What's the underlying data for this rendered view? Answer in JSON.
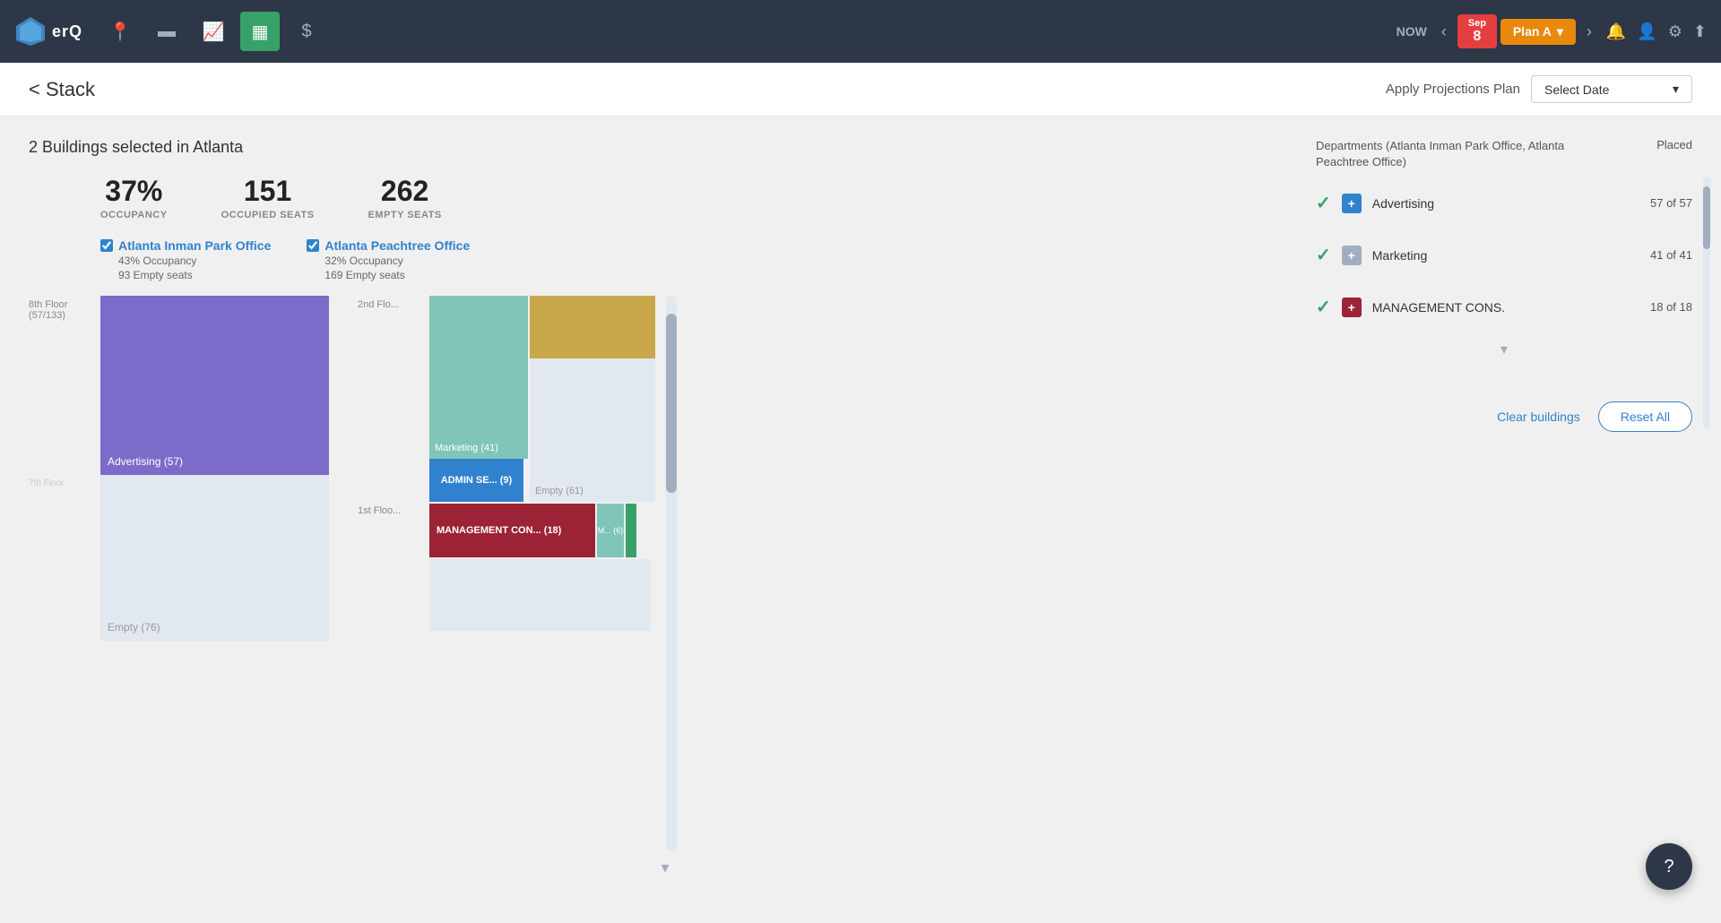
{
  "nav": {
    "now_label": "NOW",
    "date_badge_month": "Sep",
    "date_badge_day": "8",
    "plan_label": "Plan A",
    "icons": [
      "location",
      "credit-card",
      "trending-up",
      "grid",
      "dollar"
    ]
  },
  "subheader": {
    "back_link": "< Stack",
    "apply_label": "Apply Projections Plan",
    "select_date_placeholder": "Select Date"
  },
  "summary": {
    "heading": "2 Buildings selected in Atlanta",
    "occupancy_value": "37%",
    "occupancy_label": "OCCUPANCY",
    "occupied_seats_value": "151",
    "occupied_seats_label": "OCCUPIED SEATS",
    "empty_seats_value": "262",
    "empty_seats_label": "EMPTY SEATS"
  },
  "building1": {
    "name": "Atlanta Inman Park Office",
    "occupancy": "43% Occupancy",
    "empty_seats": "93 Empty seats",
    "floor8_label": "8th Floor (57/133)",
    "advertising_bar": "Advertising (57)",
    "empty_bar": "Empty (76)"
  },
  "building2": {
    "name": "Atlanta Peachtree Office",
    "occupancy": "32% Occupancy",
    "empty_seats": "169 Empty seats",
    "floor2_label": "2nd Flo...",
    "floor1_label": "1st Floo...",
    "marketing_bar": "Marketing (41)",
    "admin_bar": "ADMIN SE... (9)",
    "empty_bar": "Empty (61)",
    "mgmt_bar": "MANAGEMENT CON... (18)",
    "m_bar": "M... (6)"
  },
  "departments": {
    "title": "Departments (Atlanta Inman Park Office, Atlanta Peachtree Office)",
    "placed_label": "Placed",
    "items": [
      {
        "name": "Advertising",
        "placed": "57 of 57",
        "icon_color": "blue",
        "icon_letter": "+"
      },
      {
        "name": "Marketing",
        "placed": "41 of 41",
        "icon_color": "gray",
        "icon_letter": "+"
      },
      {
        "name": "MANAGEMENT CONS.",
        "placed": "18 of 18",
        "icon_color": "red",
        "icon_letter": "+"
      }
    ]
  },
  "footer": {
    "clear_buildings": "Clear buildings",
    "reset_all": "Reset All"
  },
  "help_icon": "?"
}
